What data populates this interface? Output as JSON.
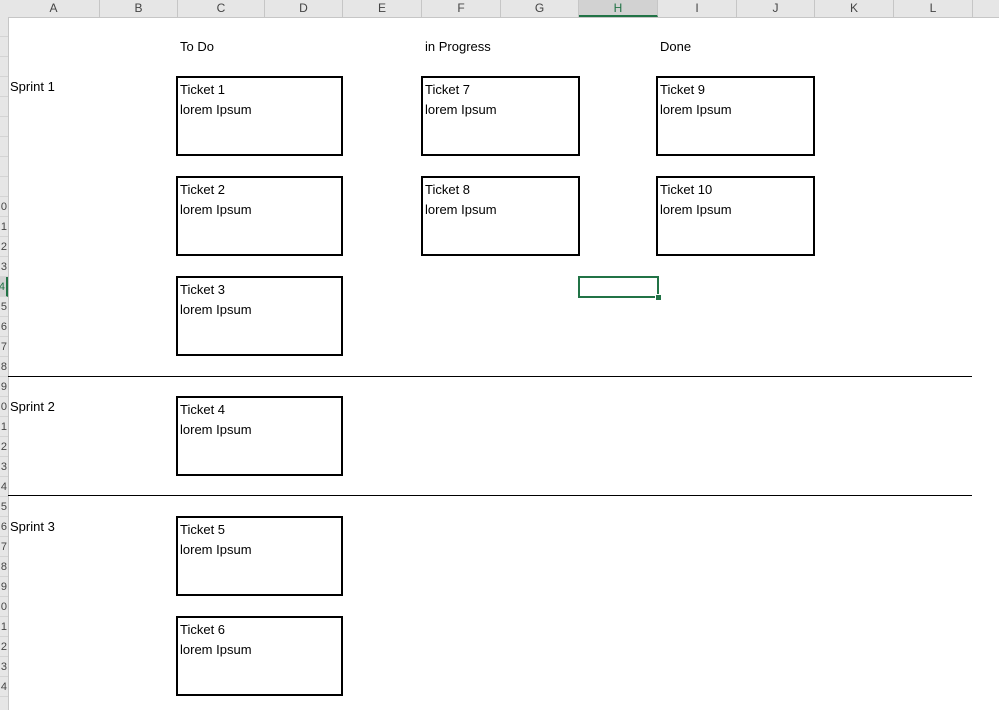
{
  "spreadsheet": {
    "columns": [
      "A",
      "B",
      "C",
      "D",
      "E",
      "F",
      "G",
      "H",
      "I",
      "J",
      "K",
      "L"
    ],
    "selected_column": "H",
    "row_numbers": [
      "",
      "",
      "",
      "",
      "",
      "",
      "",
      "",
      "",
      "0",
      "1",
      "2",
      "3",
      "4",
      "5",
      "6",
      "7",
      "8",
      "9",
      "0",
      "1",
      "2",
      "3",
      "4",
      "5",
      "6",
      "7",
      "8",
      "9",
      "0",
      "1",
      "2",
      "3",
      "4",
      ""
    ],
    "selected_row_index": 13,
    "accent_color": "#217346"
  },
  "board": {
    "column_headers": {
      "todo": "To Do",
      "in_progress": "in Progress",
      "done": "Done"
    },
    "sprints": [
      "Sprint 1",
      "Sprint 2",
      "Sprint 3"
    ],
    "tickets": {
      "t1": {
        "title": "Ticket 1",
        "body": "lorem Ipsum"
      },
      "t2": {
        "title": "Ticket 2",
        "body": "lorem Ipsum"
      },
      "t3": {
        "title": "Ticket 3",
        "body": "lorem Ipsum"
      },
      "t4": {
        "title": "Ticket 4",
        "body": "lorem Ipsum"
      },
      "t5": {
        "title": "Ticket 5",
        "body": "lorem Ipsum"
      },
      "t6": {
        "title": "Ticket 6",
        "body": "lorem Ipsum"
      },
      "t7": {
        "title": "Ticket 7",
        "body": "lorem Ipsum"
      },
      "t8": {
        "title": "Ticket 8",
        "body": "lorem Ipsum"
      },
      "t9": {
        "title": "Ticket 9",
        "body": "lorem Ipsum"
      },
      "t10": {
        "title": "Ticket 10",
        "body": "lorem Ipsum"
      }
    }
  }
}
